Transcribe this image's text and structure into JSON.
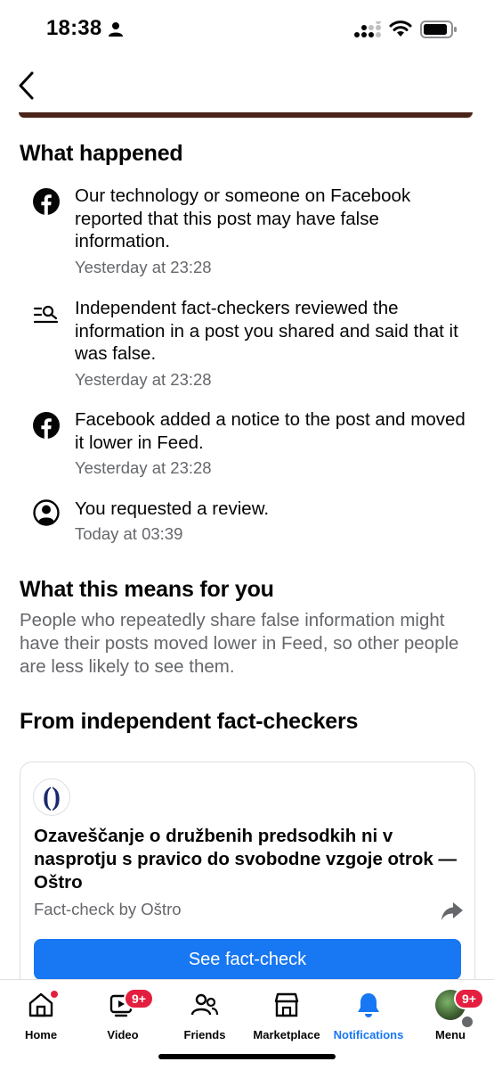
{
  "status_bar": {
    "time": "18:38"
  },
  "what_happened": {
    "title": "What happened",
    "items": [
      {
        "icon": "facebook-icon",
        "text": "Our technology or someone on Facebook reported that this post may have false information.",
        "time": "Yesterday at 23:28"
      },
      {
        "icon": "search-list-icon",
        "text": "Independent fact-checkers reviewed the information in a post you shared and said that it was false.",
        "time": "Yesterday at 23:28"
      },
      {
        "icon": "facebook-icon",
        "text": "Facebook added a notice to the post and moved it lower in Feed.",
        "time": "Yesterday at 23:28"
      },
      {
        "icon": "user-circle-icon",
        "text": "You requested a review.",
        "time": "Today at 03:39"
      }
    ]
  },
  "what_this_means": {
    "title": "What this means for you",
    "body": "People who repeatedly share false information might have their posts moved lower in Feed, so other people are less likely to see them."
  },
  "fact_checkers": {
    "title": "From independent fact-checkers",
    "card": {
      "logo_glyph": "()",
      "headline": "Ozaveščanje o družbenih predsodkih ni v nasprotju s pravico do svobodne vzgoje otrok — Oštro",
      "source": "Fact-check by Oštro",
      "button_label": "See fact-check"
    }
  },
  "bottom_nav": {
    "items": [
      {
        "label": "Home",
        "icon": "home-icon"
      },
      {
        "label": "Video",
        "icon": "video-icon",
        "badge": "9+"
      },
      {
        "label": "Friends",
        "icon": "friends-icon"
      },
      {
        "label": "Marketplace",
        "icon": "marketplace-icon"
      },
      {
        "label": "Notifications",
        "icon": "bell-icon",
        "active": true
      },
      {
        "label": "Menu",
        "icon": "avatar",
        "badge": "9+"
      }
    ]
  },
  "colors": {
    "accent": "#1877f2",
    "badge": "#e41e3f",
    "secondary_text": "#65676b"
  }
}
